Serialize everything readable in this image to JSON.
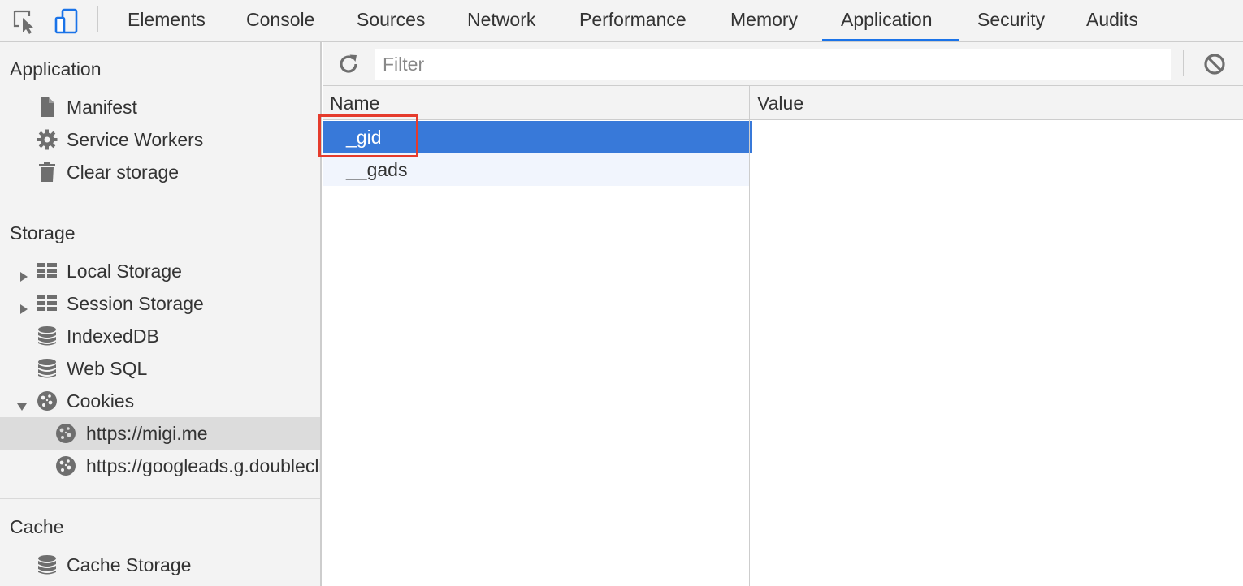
{
  "toolbar": {
    "inspect_icon": "inspect-element-icon",
    "device_icon": "device-toggle-icon"
  },
  "tabs": [
    {
      "label": "Elements"
    },
    {
      "label": "Console"
    },
    {
      "label": "Sources"
    },
    {
      "label": "Network"
    },
    {
      "label": "Performance"
    },
    {
      "label": "Memory"
    },
    {
      "label": "Application",
      "active": true
    },
    {
      "label": "Security"
    },
    {
      "label": "Audits"
    }
  ],
  "sidebar": {
    "application": {
      "title": "Application",
      "items": [
        {
          "label": "Manifest",
          "icon": "file-icon"
        },
        {
          "label": "Service Workers",
          "icon": "gear-icon"
        },
        {
          "label": "Clear storage",
          "icon": "trash-icon"
        }
      ]
    },
    "storage": {
      "title": "Storage",
      "items": [
        {
          "label": "Local Storage",
          "icon": "grid-icon",
          "expandable": true,
          "expanded": false
        },
        {
          "label": "Session Storage",
          "icon": "grid-icon",
          "expandable": true,
          "expanded": false
        },
        {
          "label": "IndexedDB",
          "icon": "database-icon"
        },
        {
          "label": "Web SQL",
          "icon": "database-icon"
        },
        {
          "label": "Cookies",
          "icon": "cookie-icon",
          "expandable": true,
          "expanded": true
        },
        {
          "label": "https://migi.me",
          "icon": "cookie-icon",
          "selected": true
        },
        {
          "label": "https://googleads.g.doubleclick.net",
          "icon": "cookie-icon"
        }
      ]
    },
    "cache": {
      "title": "Cache",
      "items": [
        {
          "label": "Cache Storage",
          "icon": "database-icon"
        }
      ]
    }
  },
  "main": {
    "filter": {
      "placeholder": "Filter",
      "value": ""
    },
    "columns": {
      "name": "Name",
      "value": "Value"
    },
    "rows": [
      {
        "name": "_gid",
        "value": "",
        "selected": true
      },
      {
        "name": "__gads",
        "value": ""
      }
    ]
  },
  "colors": {
    "accent": "#1a73e8",
    "selection": "#3879d9",
    "highlight_border": "#e53b2c",
    "sidebar_bg": "#f3f3f3"
  }
}
